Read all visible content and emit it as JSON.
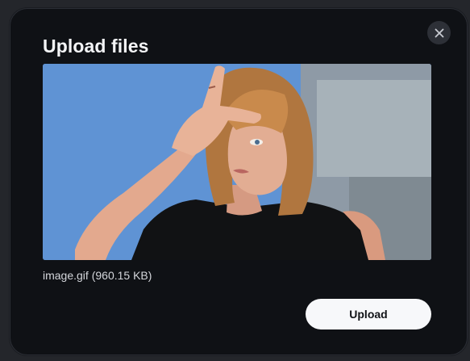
{
  "dialog": {
    "title": "Upload files",
    "close_icon": "close-icon",
    "file": {
      "name": "image.gif",
      "size": "(960.15 KB)"
    },
    "upload_label": "Upload"
  },
  "colors": {
    "dialog_bg": "#0f1115",
    "button_bg": "#f7f8fa",
    "title_text": "#f3f4f6"
  }
}
